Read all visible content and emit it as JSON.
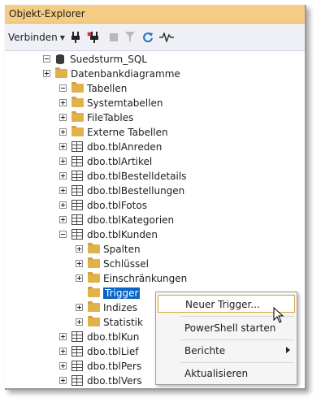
{
  "window": {
    "title": "Objekt-Explorer"
  },
  "toolbar": {
    "connect_label": "Verbinden",
    "icons": [
      "connect-icon",
      "disconnect-icon",
      "stop-icon",
      "filter-icon",
      "refresh-icon",
      "activity-icon"
    ]
  },
  "tree": {
    "server": "Suedsturm_SQL",
    "nodes": [
      {
        "label": "Datenbankdiagramme",
        "icon": "folder",
        "expander": "plus"
      },
      {
        "label": "Tabellen",
        "icon": "folder",
        "expander": "minus"
      },
      {
        "label": "Systemtabellen",
        "icon": "folder",
        "expander": "plus"
      },
      {
        "label": "FileTables",
        "icon": "folder",
        "expander": "plus"
      },
      {
        "label": "Externe Tabellen",
        "icon": "folder",
        "expander": "plus"
      },
      {
        "label": "dbo.tblAnreden",
        "icon": "table",
        "expander": "plus"
      },
      {
        "label": "dbo.tblArtikel",
        "icon": "table",
        "expander": "plus"
      },
      {
        "label": "dbo.tblBestelldetails",
        "icon": "table",
        "expander": "plus"
      },
      {
        "label": "dbo.tblBestellungen",
        "icon": "table",
        "expander": "plus"
      },
      {
        "label": "dbo.tblFotos",
        "icon": "table",
        "expander": "plus"
      },
      {
        "label": "dbo.tblKategorien",
        "icon": "table",
        "expander": "plus"
      },
      {
        "label": "dbo.tblKunden",
        "icon": "table",
        "expander": "minus"
      },
      {
        "label": "Spalten",
        "icon": "folder",
        "expander": "plus"
      },
      {
        "label": "Schlüssel",
        "icon": "folder",
        "expander": "plus"
      },
      {
        "label": "Einschränkungen",
        "icon": "folder",
        "expander": "plus"
      },
      {
        "label": "Trigger",
        "icon": "folder",
        "expander": "none",
        "selected": true
      },
      {
        "label": "Indizes",
        "icon": "folder",
        "expander": "plus"
      },
      {
        "label": "Statistik",
        "icon": "folder",
        "expander": "plus"
      },
      {
        "label": "dbo.tblKun",
        "icon": "table",
        "expander": "plus"
      },
      {
        "label": "dbo.tblLief",
        "icon": "table",
        "expander": "plus"
      },
      {
        "label": "dbo.tblPers",
        "icon": "table",
        "expander": "plus"
      },
      {
        "label": "dbo.tblVers",
        "icon": "table",
        "expander": "plus"
      }
    ]
  },
  "context_menu": {
    "items": [
      {
        "label": "Neuer Trigger...",
        "highlighted": true
      },
      {
        "label": "PowerShell starten"
      },
      {
        "label": "Berichte",
        "submenu": true
      },
      {
        "label": "Aktualisieren"
      }
    ]
  },
  "colors": {
    "title_bar": "#f5cc84",
    "selection": "#0a64c8",
    "menu_highlight_border": "#d8a63e",
    "folder": "#e2b24a"
  }
}
